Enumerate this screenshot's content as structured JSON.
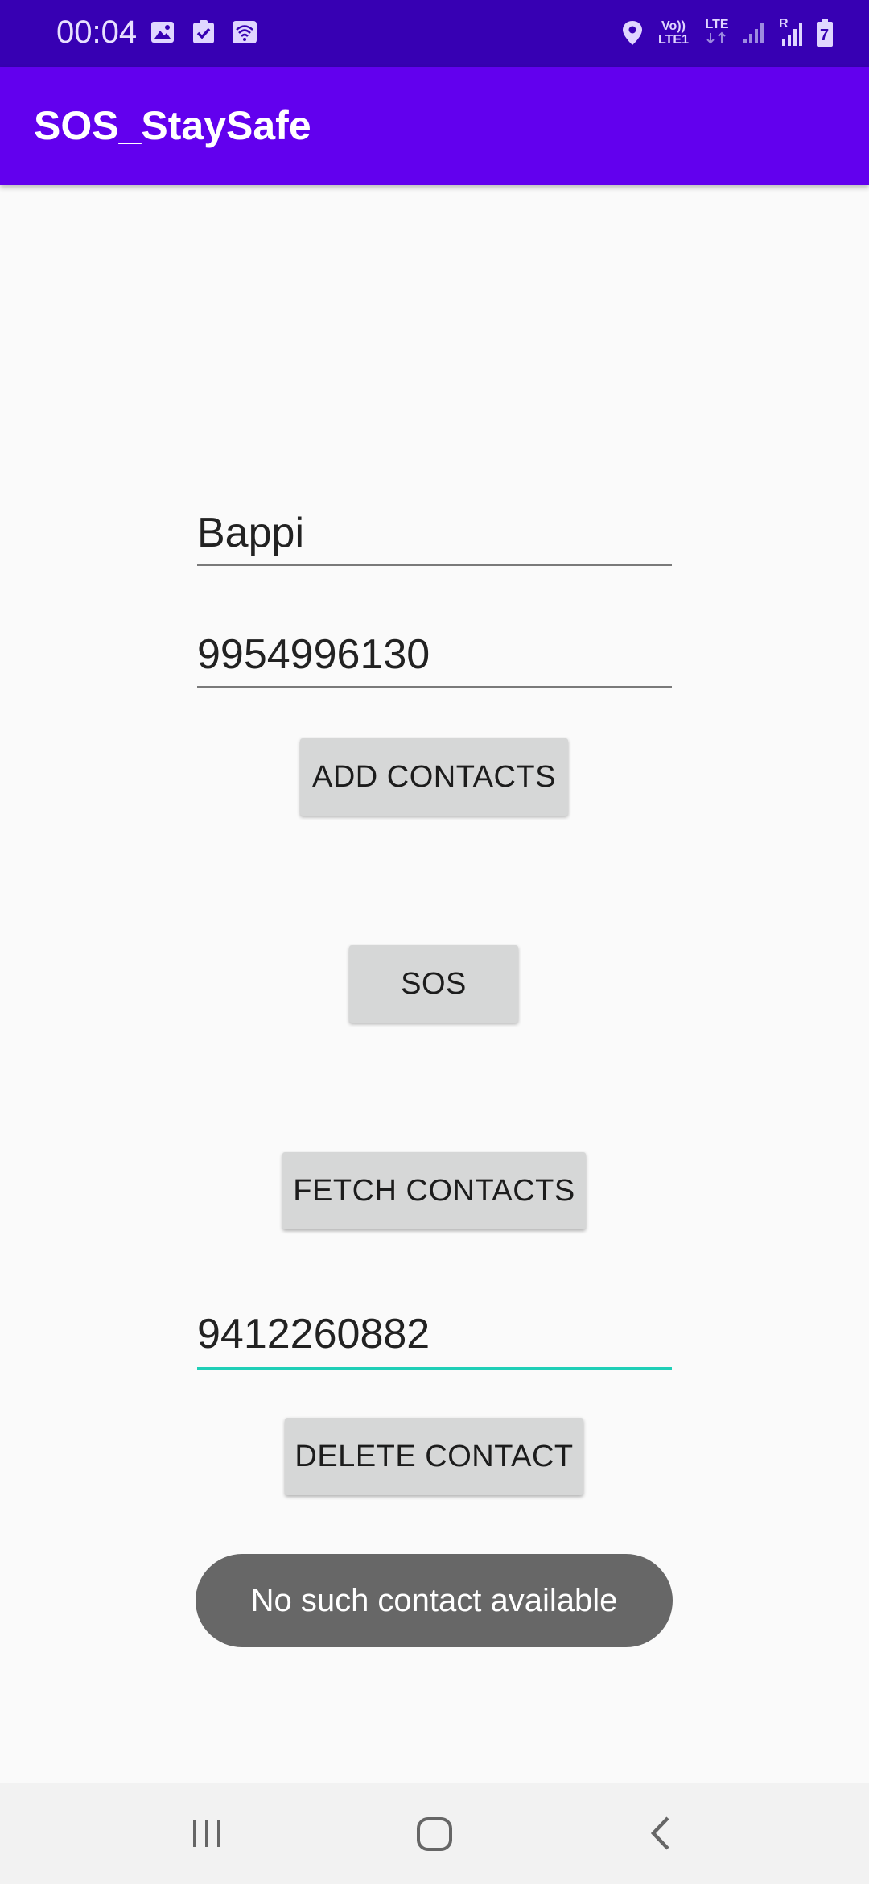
{
  "status_bar": {
    "time": "00:04",
    "left_icons": [
      "image-icon",
      "checkbox-icon",
      "wifi-icon"
    ],
    "right_icons": [
      "location-icon",
      "volte-icon",
      "lte-icon",
      "signal-icon",
      "signal-roaming-icon",
      "battery-charging-icon"
    ],
    "volte_line1": "Vo))",
    "volte_line2": "LTE1",
    "lte_label": "LTE",
    "roaming_label": "R",
    "battery_level": "7"
  },
  "app_bar": {
    "title": "SOS_StaySafe",
    "color": "#6200ee"
  },
  "form": {
    "name_value": "Bappi",
    "phone_value": "9954996130",
    "add_button": "ADD CONTACTS",
    "sos_button": "SOS",
    "fetch_button": "FETCH CONTACTS",
    "delete_phone_value": "9412260882",
    "delete_button": "DELETE CONTACT"
  },
  "toast": {
    "message": "No such contact available"
  },
  "nav_bar": {
    "buttons": [
      "recents-icon",
      "home-icon",
      "back-icon"
    ]
  },
  "colors": {
    "status_bar": "#3700b3",
    "accent_underline": "#1fcfb7",
    "button_bg": "#d6d7d7"
  }
}
